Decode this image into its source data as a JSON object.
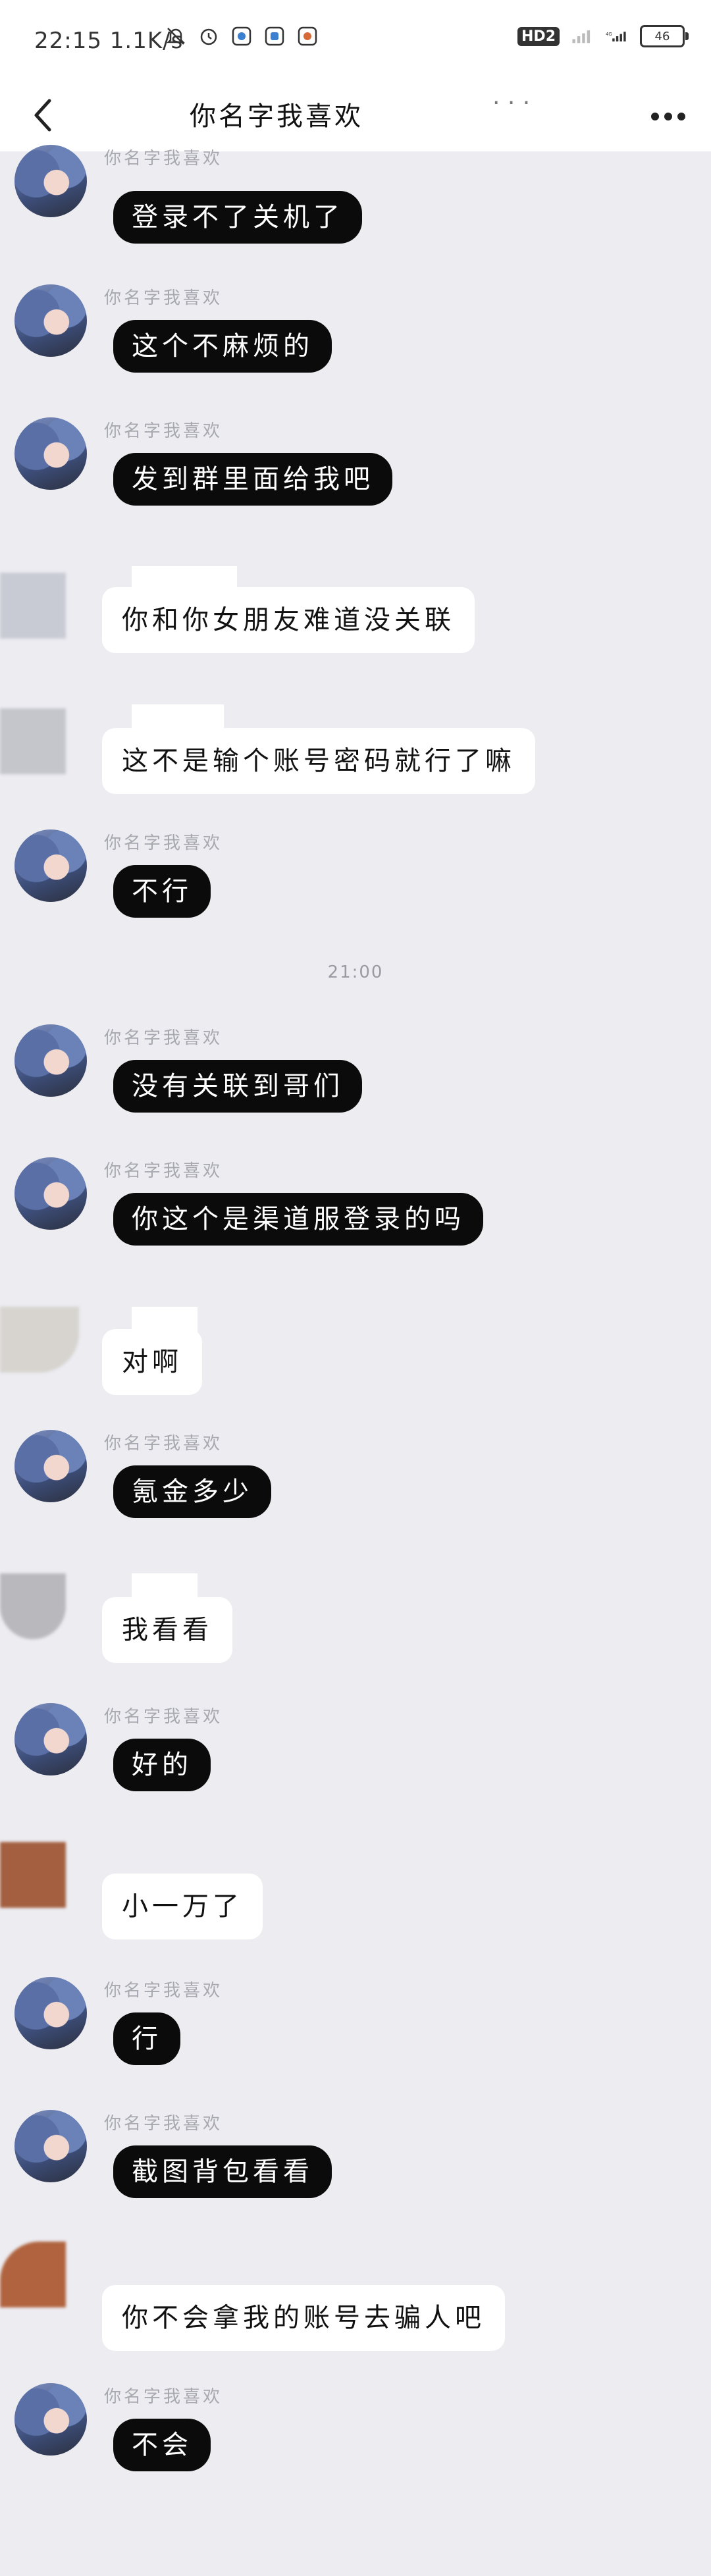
{
  "status_bar": {
    "time": "22:15",
    "speed": "1.1K/s",
    "left_icons": [
      "mute-icon",
      "alarm-icon",
      "app-icon-1",
      "app-icon-2",
      "app-icon-3"
    ],
    "hd_label": "HD2",
    "battery": "46"
  },
  "nav": {
    "title": "你名字我喜欢",
    "title_dots": "· · ·"
  },
  "messages": [
    {
      "side": "left",
      "sender": "你名字我喜欢",
      "text": "登录不了关机了"
    },
    {
      "side": "left",
      "sender": "你名字我喜欢",
      "text": "这个不麻烦的"
    },
    {
      "side": "left",
      "sender": "你名字我喜欢",
      "text": "发到群里面给我吧"
    },
    {
      "side": "right",
      "text": "你和你女朋友难道没关联"
    },
    {
      "side": "right",
      "text": "这不是输个账号密码就行了嘛"
    },
    {
      "side": "left",
      "sender": "你名字我喜欢",
      "text": "不行"
    },
    {
      "type": "time",
      "text": "21:00"
    },
    {
      "side": "left",
      "sender": "你名字我喜欢",
      "text": "没有关联到哥们"
    },
    {
      "side": "left",
      "sender": "你名字我喜欢",
      "text": "你这个是渠道服登录的吗"
    },
    {
      "side": "right",
      "text": "对啊"
    },
    {
      "side": "left",
      "sender": "你名字我喜欢",
      "text": "氪金多少"
    },
    {
      "side": "right",
      "text": "我看看"
    },
    {
      "side": "left",
      "sender": "你名字我喜欢",
      "text": "好的"
    },
    {
      "side": "right",
      "text": "小一万了"
    },
    {
      "side": "left",
      "sender": "你名字我喜欢",
      "text": "行"
    },
    {
      "side": "left",
      "sender": "你名字我喜欢",
      "text": "截图背包看看"
    },
    {
      "side": "right",
      "text": "你不会拿我的账号去骗人吧"
    },
    {
      "side": "left",
      "sender": "你名字我喜欢",
      "text": "不会"
    }
  ]
}
